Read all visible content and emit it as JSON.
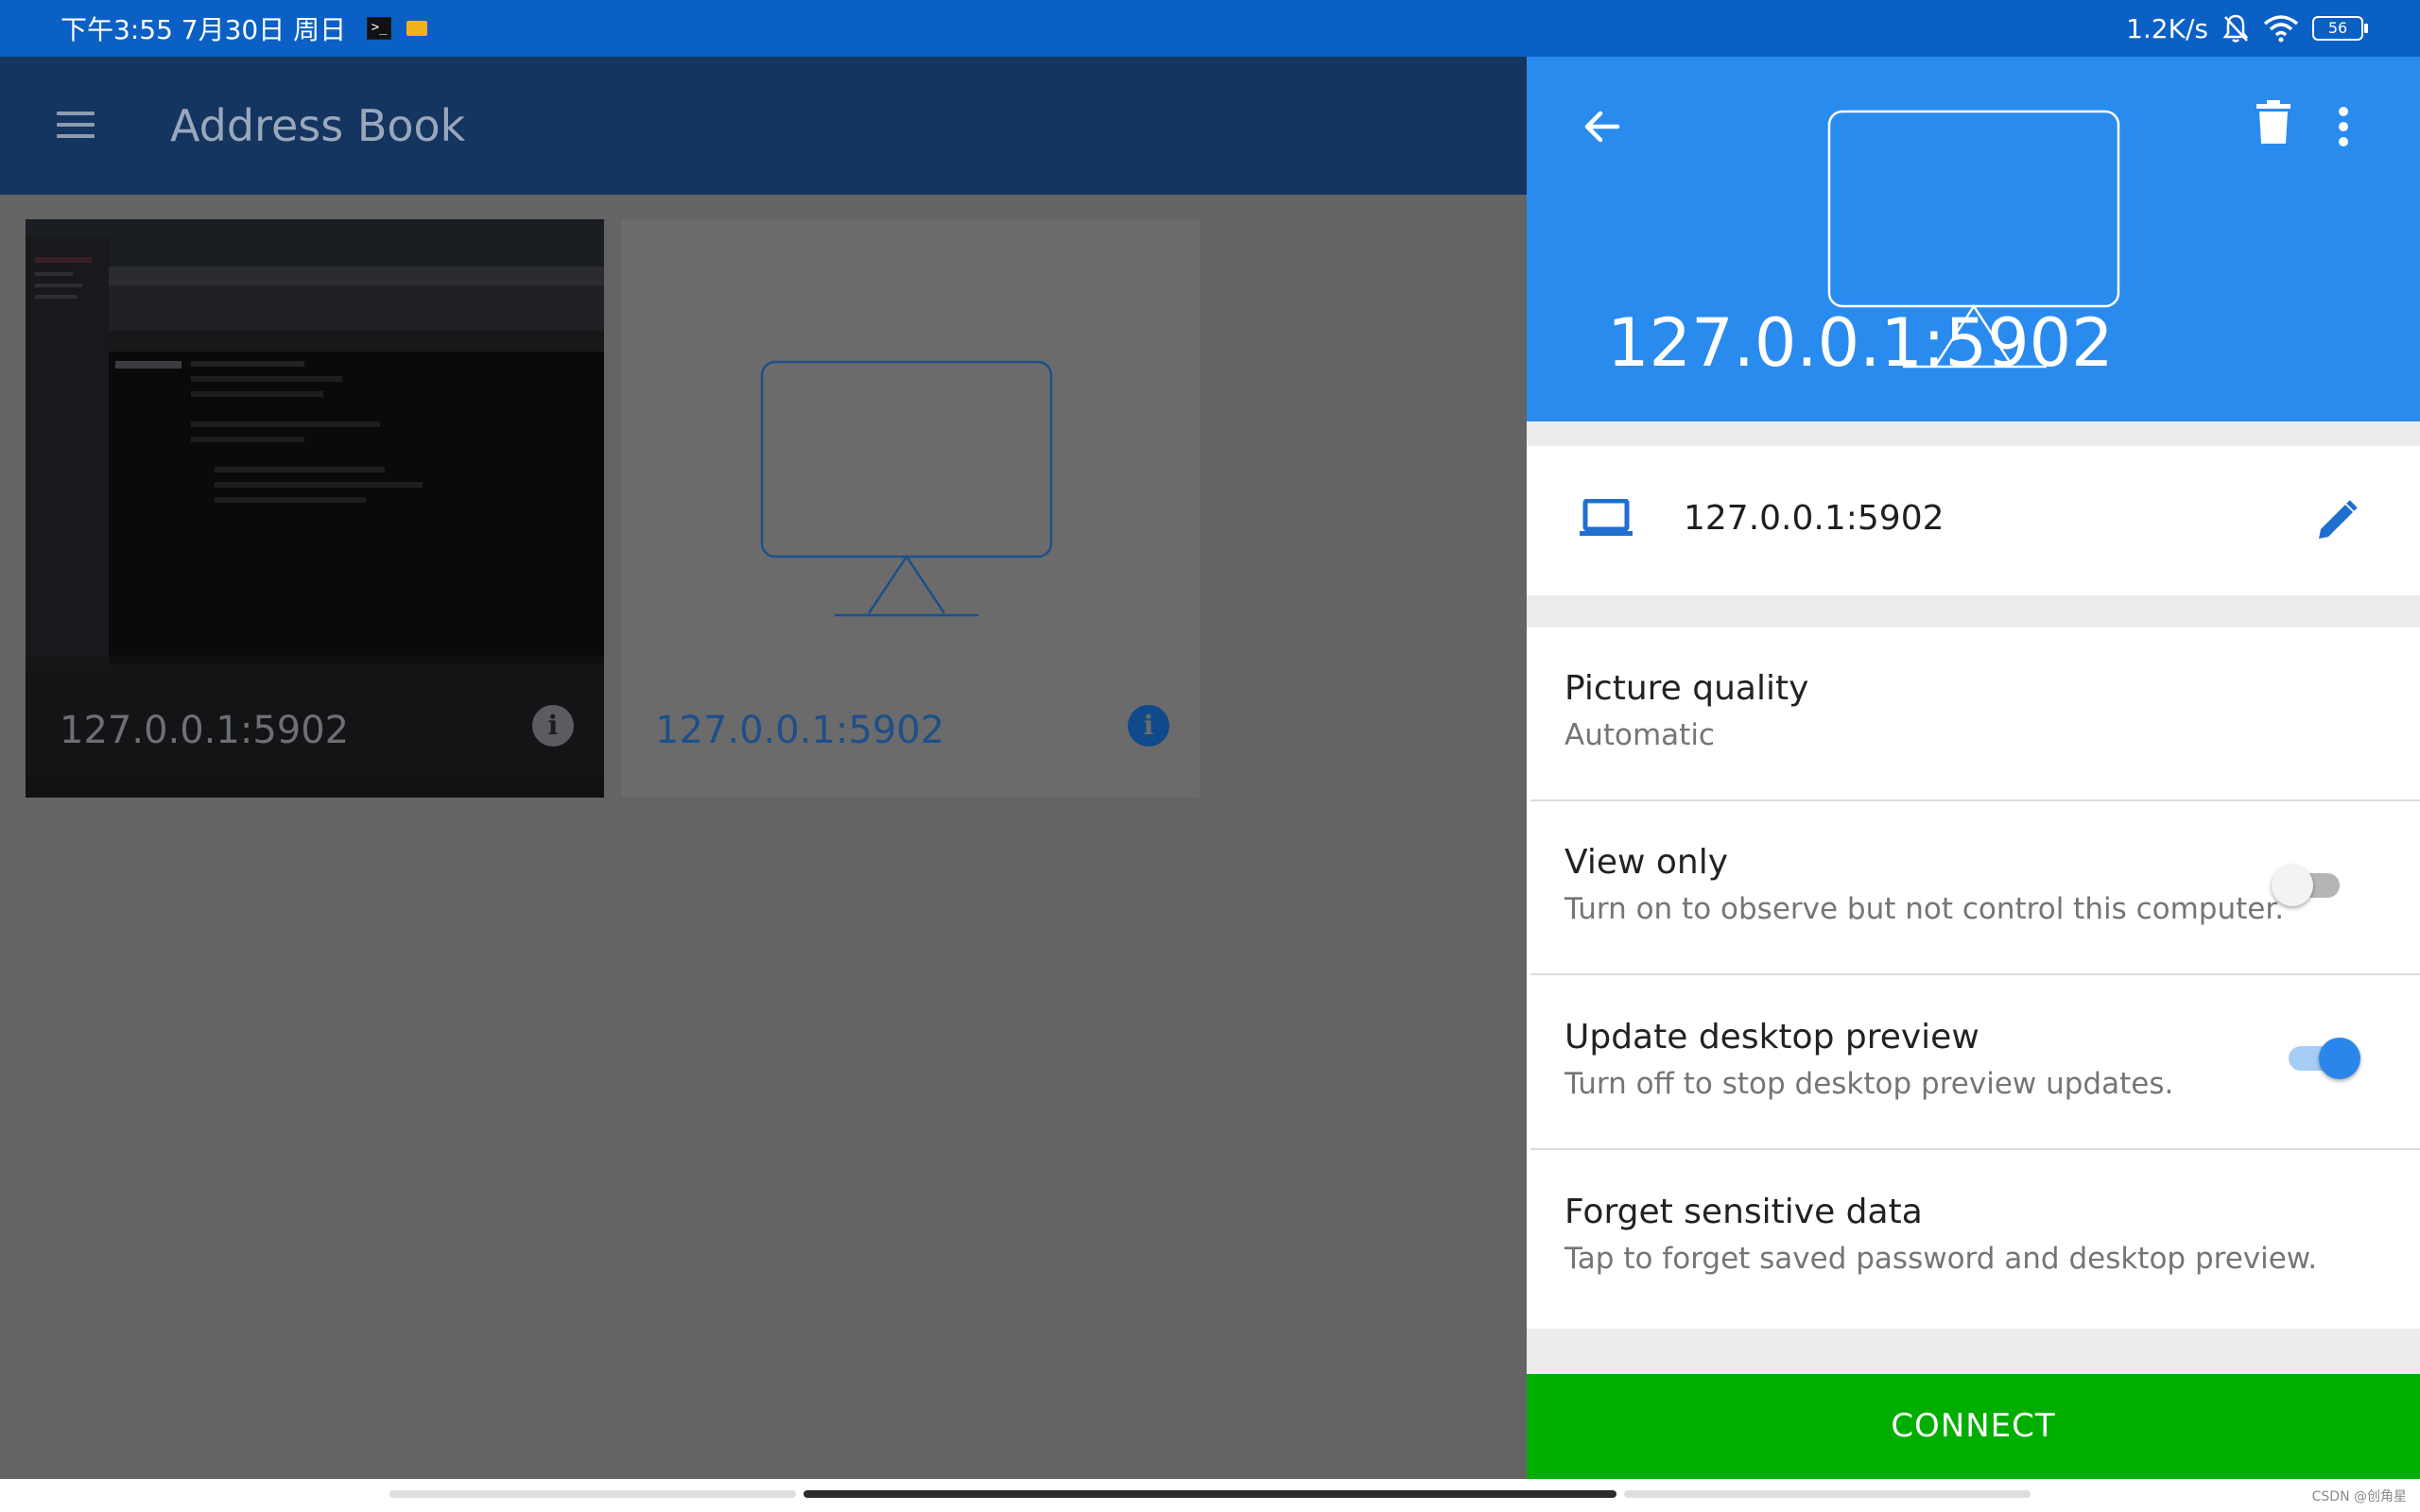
{
  "status_bar": {
    "time_date": "下午3:55 7月30日 周日",
    "network_speed": "1.2K/s",
    "battery": "56",
    "icons": [
      "terminal-icon",
      "mail-icon",
      "bell-muted-icon",
      "wifi-icon",
      "battery-icon"
    ]
  },
  "app": {
    "title": "Address Book",
    "cards": [
      {
        "label": "127.0.0.1:5902",
        "has_preview": true
      },
      {
        "label": "127.0.0.1:5902",
        "has_preview": false
      }
    ]
  },
  "details": {
    "header_title": "127.0.0.1:5902",
    "host": "127.0.0.1:5902",
    "settings": [
      {
        "title": "Picture quality",
        "subtitle": "Automatic"
      },
      {
        "title": "View only",
        "subtitle": "Turn on to observe but not control this computer.",
        "toggle": false
      },
      {
        "title": "Update desktop preview",
        "subtitle": "Turn off to stop desktop preview updates.",
        "toggle": true
      },
      {
        "title": "Forget sensitive data",
        "subtitle": "Tap to forget saved password and desktop preview."
      }
    ],
    "connect_label": "CONNECT"
  },
  "watermark": "CSDN @创角星",
  "colors": {
    "status_bar": "#0b60c5",
    "header_blue": "#2a8bef",
    "connect_green": "#00ae00",
    "toggle_on": "#2a86eb"
  }
}
